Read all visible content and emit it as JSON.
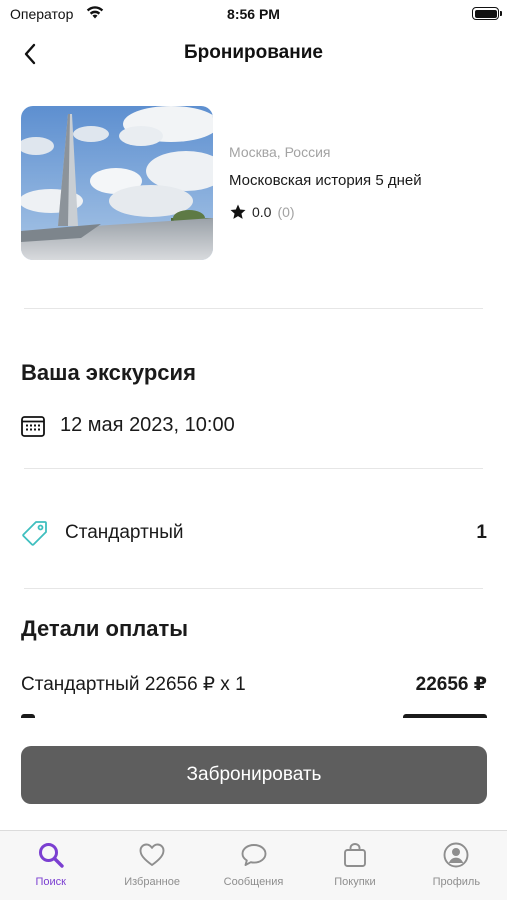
{
  "status_bar": {
    "carrier": "Оператор",
    "time": "8:56 PM"
  },
  "nav": {
    "title": "Бронирование"
  },
  "tour": {
    "location": "Москва, Россия",
    "name": "Московская история 5 дней",
    "rating": "0.0",
    "reviews": "(0)"
  },
  "excursion": {
    "title": "Ваша экскурсия",
    "date": "12 мая 2023, 10:00"
  },
  "ticket": {
    "type": "Стандартный",
    "count": "1"
  },
  "payment": {
    "title": "Детали оплаты",
    "rows": [
      {
        "label": "Стандартный 22656 ₽ х 1",
        "amount": "22656 ₽"
      }
    ]
  },
  "book_button": {
    "label": "Забронировать"
  },
  "tabs": [
    {
      "label": "Поиск",
      "icon": "search-icon",
      "active": true
    },
    {
      "label": "Избранное",
      "icon": "heart-icon",
      "active": false
    },
    {
      "label": "Сообщения",
      "icon": "chat-bubble-icon",
      "active": false
    },
    {
      "label": "Покупки",
      "icon": "shopping-bag-icon",
      "active": false
    },
    {
      "label": "Профиль",
      "icon": "profile-icon",
      "active": false
    }
  ],
  "colors": {
    "accent": "#7b3fd1",
    "button": "#5e5e5e",
    "tag_icon": "#3fbfbf"
  }
}
